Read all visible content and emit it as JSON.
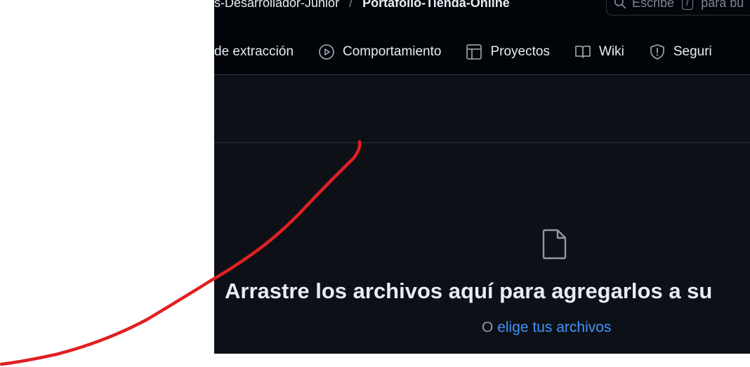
{
  "breadcrumb": {
    "owner": "s-Desarrollador-Junior",
    "separator": "/",
    "repo": "Portafolio-Tienda-Online"
  },
  "search": {
    "prefix": "Escribe",
    "key": "/",
    "suffix": "para bu"
  },
  "tabs": [
    {
      "label": "de extracción",
      "icon": "pull-request-icon"
    },
    {
      "label": "Comportamiento",
      "icon": "play-icon"
    },
    {
      "label": "Proyectos",
      "icon": "table-icon"
    },
    {
      "label": "Wiki",
      "icon": "book-icon"
    },
    {
      "label": "Seguri",
      "icon": "shield-icon"
    }
  ],
  "dropzone": {
    "icon": "file-icon",
    "title": "Arrastre los archivos aquí para agregarlos a su",
    "prefix": "O",
    "link": "elige tus archivos"
  },
  "colors": {
    "background": "#0d1117",
    "header": "#010409",
    "link": "#4493f8",
    "annotation": "#e02020"
  }
}
